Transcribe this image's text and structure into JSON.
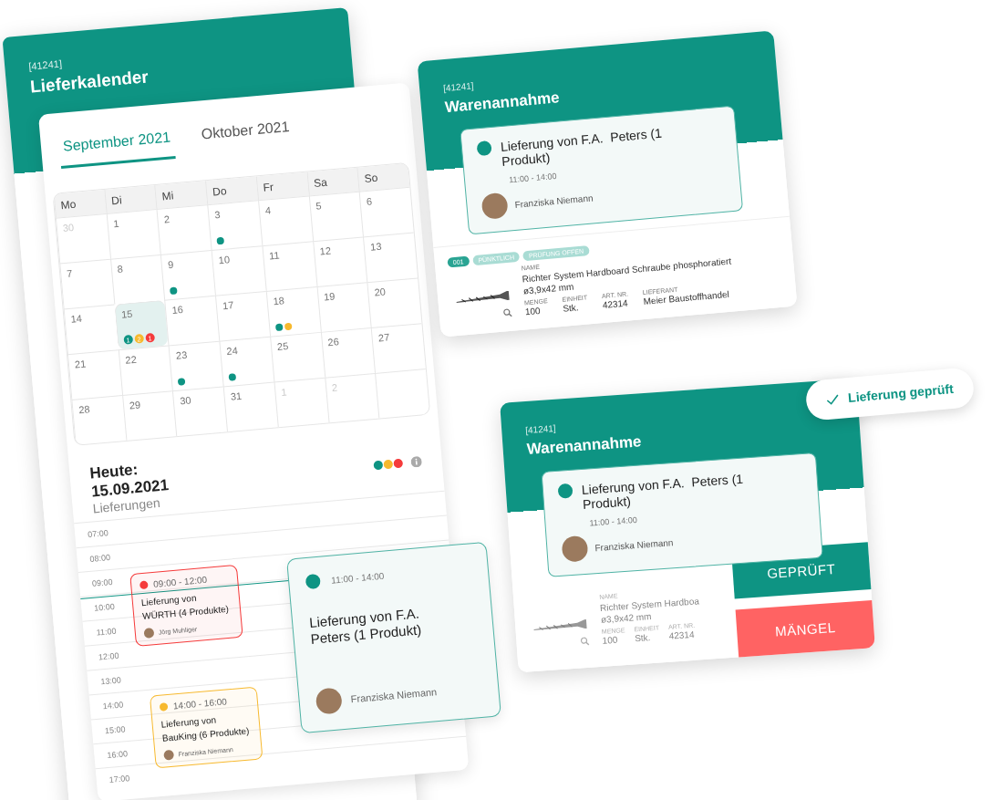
{
  "calendar_app": {
    "code": "[41241]",
    "title": "Lieferkalender",
    "tabs": [
      {
        "label": "September 2021",
        "selected": true
      },
      {
        "label": "Oktober 2021",
        "selected": false
      }
    ],
    "weekdays": [
      "Mo",
      "Di",
      "Mi",
      "Do",
      "Fr",
      "Sa",
      "So"
    ],
    "weeks": [
      [
        {
          "day": "30",
          "muted": true,
          "selected": false
        },
        {
          "day": "1",
          "muted": false,
          "selected": false
        },
        {
          "day": "2",
          "muted": false,
          "selected": false
        },
        {
          "day": "3",
          "muted": false,
          "selected": false,
          "dots": [
            {
              "color": "#0e9483"
            }
          ]
        },
        {
          "day": "4",
          "muted": false,
          "selected": false
        },
        {
          "day": "5",
          "muted": false,
          "selected": false
        },
        {
          "day": "6",
          "muted": false,
          "selected": false
        }
      ],
      [
        {
          "day": "7",
          "muted": false,
          "selected": false
        },
        {
          "day": "8",
          "muted": false,
          "selected": false
        },
        {
          "day": "9",
          "muted": false,
          "selected": false,
          "dots": [
            {
              "color": "#0e9483"
            }
          ]
        },
        {
          "day": "10",
          "muted": false,
          "selected": false
        },
        {
          "day": "11",
          "muted": false,
          "selected": false
        },
        {
          "day": "12",
          "muted": false,
          "selected": false
        },
        {
          "day": "13",
          "muted": false,
          "selected": false
        }
      ],
      [
        {
          "day": "14",
          "muted": false,
          "selected": false
        },
        {
          "day": "15",
          "muted": false,
          "selected": true,
          "dots": [
            {
              "color": "#0e9483",
              "count": "1"
            },
            {
              "color": "#f7b92e",
              "count": "2"
            },
            {
              "color": "#f53b3b",
              "count": "1"
            }
          ]
        },
        {
          "day": "16",
          "muted": false,
          "selected": false
        },
        {
          "day": "17",
          "muted": false,
          "selected": false
        },
        {
          "day": "18",
          "muted": false,
          "selected": false,
          "dots": [
            {
              "color": "#0e9483"
            },
            {
              "color": "#f7b92e"
            }
          ]
        },
        {
          "day": "19",
          "muted": false,
          "selected": false
        },
        {
          "day": "20",
          "muted": false,
          "selected": false
        }
      ],
      [
        {
          "day": "21",
          "muted": false,
          "selected": false
        },
        {
          "day": "22",
          "muted": false,
          "selected": false
        },
        {
          "day": "23",
          "muted": false,
          "selected": false,
          "dots": [
            {
              "color": "#0e9483"
            }
          ]
        },
        {
          "day": "24",
          "muted": false,
          "selected": false,
          "dots": [
            {
              "color": "#0e9483"
            }
          ]
        },
        {
          "day": "25",
          "muted": false,
          "selected": false
        },
        {
          "day": "26",
          "muted": false,
          "selected": false
        },
        {
          "day": "27",
          "muted": false,
          "selected": false
        }
      ],
      [
        {
          "day": "28",
          "muted": false,
          "selected": false
        },
        {
          "day": "29",
          "muted": false,
          "selected": false
        },
        {
          "day": "30",
          "muted": false,
          "selected": false
        },
        {
          "day": "31",
          "muted": false,
          "selected": false
        },
        {
          "day": "1",
          "muted": true,
          "selected": false
        },
        {
          "day": "2",
          "muted": true,
          "selected": false
        }
      ]
    ],
    "today": {
      "heading": "Heute:",
      "date": "15.09.2021",
      "subtitle": "Lieferungen"
    },
    "legend": [
      {
        "color": "#0e9483"
      },
      {
        "color": "#f7b92e"
      },
      {
        "color": "#f53b3b"
      }
    ],
    "hours": [
      {
        "label": "07:00"
      },
      {
        "label": "08:00"
      },
      {
        "label": "09:00",
        "events": [
          {
            "time": "09:00 - 12:00",
            "title": "Lieferung von WÜRTH (4 Produkte)",
            "person": "Jörg Muhliger",
            "color": "#f53b3b"
          }
        ]
      },
      {
        "label": "10:00"
      },
      {
        "label": "11:00"
      },
      {
        "label": "12:00"
      },
      {
        "label": "13:00"
      },
      {
        "label": "14:00",
        "events": [
          {
            "time": "14:00 - 16:00",
            "title": "Lieferung von BauKing (6 Produkte)",
            "person": "Franziska Niemann",
            "color": "#f7b92e"
          }
        ]
      },
      {
        "label": "15:00"
      },
      {
        "label": "16:00"
      },
      {
        "label": "17:00"
      }
    ]
  },
  "delivery_popup": {
    "color": "#0e9483",
    "time": "11:00 - 14:00",
    "title": "Lieferung von F.A. Peters (1 Produkt)",
    "person": "Franziska Niemann"
  },
  "goods_receipts": [
    {
      "code": "[41241]",
      "title": "Warenannahme",
      "faded": false,
      "delivery": {
        "color": "#0e9483",
        "title": "Lieferung von F.A.  Peters (1 Produkt)",
        "time": "11:00 - 14:00",
        "person": "Franziska Niemann"
      },
      "product": {
        "tags": [
          {
            "label": "001",
            "kind": "id"
          },
          {
            "label": "PÜNKTLICH",
            "kind": "status"
          },
          {
            "label": "PRÜFUNG OFFEN",
            "kind": "status"
          }
        ],
        "name_label": "NAME",
        "name": "Richter System Hardboard Schraube phosphoratiert ø3,9x42 mm",
        "fields": [
          {
            "label": "MENGE",
            "value": "100"
          },
          {
            "label": "EINHEIT",
            "value": "Stk."
          },
          {
            "label": "ART. NR.",
            "value": "42314"
          },
          {
            "label": "LIEFERANT",
            "value": "Meier Baustoffhandel"
          }
        ]
      }
    },
    {
      "code": "[41241]",
      "title": "Warenannahme",
      "faded": true,
      "delivery": {
        "color": "#0e9483",
        "title": "Lieferung von F.A.  Peters (1 Produkt)",
        "time": "11:00 - 14:00",
        "person": "Franziska Niemann"
      },
      "product": {
        "name_label": "NAME",
        "name": "Richter System Hardboa ø3,9x42 mm",
        "fields": [
          {
            "label": "MENGE",
            "value": "100"
          },
          {
            "label": "EINHEIT",
            "value": "Stk."
          },
          {
            "label": "ART. NR.",
            "value": "42314"
          }
        ]
      },
      "actions": [
        {
          "label": "GEPRÜFT",
          "kind": "confirm"
        },
        {
          "label": "MÄNGEL",
          "kind": "defect"
        }
      ]
    }
  ],
  "status_badge": {
    "label": "Lieferung geprüft"
  }
}
